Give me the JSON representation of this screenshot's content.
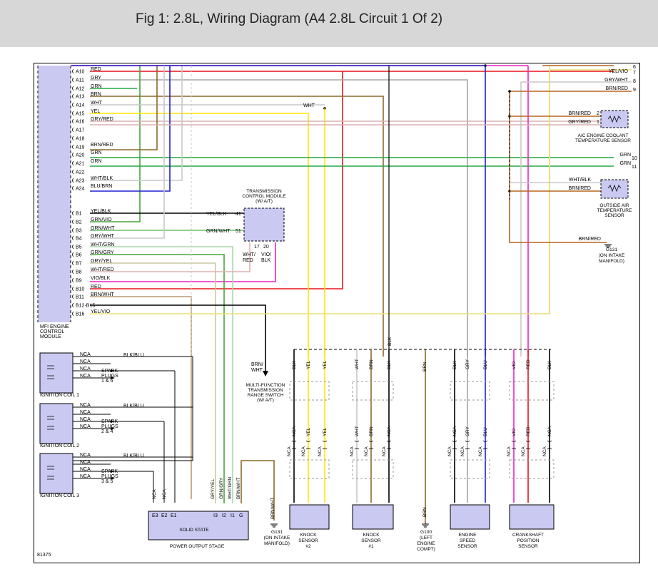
{
  "header": {
    "title": "Fig 1: 2.8L, Wiring Diagram (A4 2.8L Circuit 1 Of 2)"
  },
  "figure_number": "81375",
  "ecm": {
    "label_lines": [
      "MFI ENGINE",
      "CONTROL",
      "MODULE"
    ],
    "pins": [
      {
        "pin": "A10",
        "wire": "RED",
        "color": "#e8141b"
      },
      {
        "pin": "A11",
        "wire": "GRY",
        "color": "#a6a6a6"
      },
      {
        "pin": "A12",
        "wire": "GRN",
        "color": "#22a845"
      },
      {
        "pin": "A13",
        "wire": "BRN",
        "color": "#8a6a2b"
      },
      {
        "pin": "A14",
        "wire": "WHT",
        "color": "#bdbdbd"
      },
      {
        "pin": "A15",
        "wire": "YEL",
        "color": "#ffee00"
      },
      {
        "pin": "A16",
        "wire": "GRY/RED",
        "color": "#d8b0b0"
      },
      {
        "pin": "A17",
        "wire": "",
        "color": ""
      },
      {
        "pin": "A18",
        "wire": "",
        "color": ""
      },
      {
        "pin": "A19",
        "wire": "BRN/RED",
        "color": "#b5651d"
      },
      {
        "pin": "A20",
        "wire": "GRN",
        "color": "#22a845"
      },
      {
        "pin": "A21",
        "wire": "GRN",
        "color": "#22a845"
      },
      {
        "pin": "A22",
        "wire": "",
        "color": ""
      },
      {
        "pin": "A23",
        "wire": "WHT/BLK",
        "color": "#c8c8c8"
      },
      {
        "pin": "A24",
        "wire": "BLU/BRN",
        "color": "#3b3bd0"
      },
      {
        "pin": "B1",
        "wire": "YEL/BLK",
        "color": "#000000"
      },
      {
        "pin": "B2",
        "wire": "GRN/VIO",
        "color": "#4aa43c"
      },
      {
        "pin": "B3",
        "wire": "GRN/WHT",
        "color": "#6dbb6d"
      },
      {
        "pin": "B4",
        "wire": "GRY/WHT",
        "color": "#c8c8c8"
      },
      {
        "pin": "B5",
        "wire": "WHT/GRN",
        "color": "#a8d8a8"
      },
      {
        "pin": "B6",
        "wire": "GRN/GRY",
        "color": "#4aa43c"
      },
      {
        "pin": "B7",
        "wire": "GRY/YEL",
        "color": "#c8c8a0"
      },
      {
        "pin": "B8",
        "wire": "WHT/RED",
        "color": "#e0b0b0"
      },
      {
        "pin": "B9",
        "wire": "VIO/BLK",
        "color": "#ee22cc"
      },
      {
        "pin": "B10",
        "wire": "RED",
        "color": "#e8141b"
      },
      {
        "pin": "B11",
        "wire": "BRN/WHT",
        "color": "#b89b70"
      },
      {
        "pin": "B12-B15",
        "wire": "",
        "color": ""
      },
      {
        "pin": "B16",
        "wire": "YEL/VIO",
        "color": "#ece070"
      }
    ]
  },
  "top_right_wires": [
    {
      "label": "",
      "num": "6"
    },
    {
      "label": "YEL/VIO",
      "num": "7"
    },
    {
      "label": "GRY/WHT",
      "num": "8"
    },
    {
      "label": "BRN/RED",
      "num": "9"
    }
  ],
  "wht_label": "WHT",
  "tcm": {
    "label_lines": [
      "TRANSMISSION",
      "CONTROL MODULE",
      "(W/ A/T)"
    ],
    "pin41": "41",
    "pin51": "51",
    "pin17": "17",
    "pin20": "20",
    "wire41": "YEL/BLK",
    "wire51": "GRN/WHT",
    "wire17_lines": [
      "WHT/",
      "RED"
    ],
    "wire20_lines": [
      "VIO/",
      "BLK"
    ]
  },
  "coolant_sensor": {
    "wires": [
      "BRN/RED",
      "GRY/RED"
    ],
    "pins": [
      "2",
      "1"
    ],
    "label_lines": [
      "A/C ENGINE COOLANT",
      "TEMPERATURE SENSOR"
    ]
  },
  "grn_wires": [
    {
      "label": "GRN",
      "num": "10"
    },
    {
      "label": "GRN",
      "num": "11"
    }
  ],
  "outside_air_sensor": {
    "wires": [
      "WHT/BLK",
      "BRN/RED"
    ],
    "label_lines": [
      "OUTSIDE AIR",
      "TEMPERATURE",
      "SENSOR"
    ]
  },
  "g131_right": {
    "wire": "BRN/RED",
    "label_lines": [
      "G131",
      "(ON INTAKE",
      "MANIFOLD)"
    ]
  },
  "mftrs": {
    "wire_lines": [
      "BRN/",
      "WHT"
    ],
    "label_lines": [
      "MULTI-FUNCTION",
      "TRANSMISSION",
      "RANGE SWITCH",
      "(W/ A/T)"
    ]
  },
  "coils": [
    {
      "label": "IGNITION COIL 1",
      "ground": "BLK/BLU",
      "nca": [
        "NCA",
        "NCA",
        "NCA",
        "NCA"
      ],
      "plugs_lines": [
        "SPARK",
        "PLUGS",
        "1 & 6"
      ]
    },
    {
      "label": "IGNITION COIL 2",
      "ground": "BLK/BLU",
      "nca": [
        "NCA",
        "NCA",
        "NCA",
        "NCA"
      ],
      "plugs_lines": [
        "SPARK",
        "PLUGS",
        "2 & 4"
      ]
    },
    {
      "label": "IGNITION COIL 3",
      "ground": "BLK/BLU",
      "nca": [
        "NCA",
        "NCA",
        "NCA",
        "NCA"
      ],
      "plugs_lines": [
        "SPARK",
        "PLUGS",
        "3 & 5"
      ]
    }
  ],
  "output_stage": {
    "label": "SOLID STATE",
    "caption": "POWER OUTPUT STAGE",
    "pins": [
      "E3",
      "E2",
      "E1",
      "I3",
      "I2",
      "I1",
      "G"
    ],
    "nca_labels": [
      "NCA",
      "NCA"
    ],
    "input_wires": [
      "GRY/YEL",
      "GRN/GRY",
      "WHT/GRN",
      "BRN/WHT"
    ],
    "wire_nums": [
      "1",
      "2",
      "3",
      "4",
      "1",
      "2",
      "3",
      "4"
    ]
  },
  "g131_left": {
    "wire": "BRN/WHT",
    "label_lines": [
      "G131",
      "(ON INTAKE",
      "MANIFOLD)"
    ]
  },
  "g100": {
    "wire": "BRN",
    "label_lines": [
      "G100",
      "(LEFT",
      "ENGINE",
      "COMPT)"
    ]
  },
  "blk_label": "BLK",
  "sensors": [
    {
      "name": "knock2",
      "label_lines": [
        "KNOCK",
        "SENSOR",
        "#2"
      ],
      "top_wires": [
        "BLK",
        "YEL",
        "YEL"
      ],
      "mid_wires": [
        "NCA",
        "YEL",
        "YEL"
      ],
      "nca": [
        "NCA",
        "NCA",
        "NCA"
      ]
    },
    {
      "name": "knock1",
      "label_lines": [
        "KNOCK",
        "SENSOR",
        "#1"
      ],
      "top_wires": [
        "WHT",
        "BRN",
        "BLK"
      ],
      "mid_wires": [
        "WHT",
        "BRN",
        "NCA"
      ],
      "nca": [
        "NCA",
        "NCA",
        "NCA"
      ]
    },
    {
      "name": "speed",
      "label_lines": [
        "ENGINE",
        "SPEED",
        "SENSOR"
      ],
      "top_wires": [
        "BLK",
        "GRY",
        "BLU"
      ],
      "mid_wires": [
        "NCA",
        "GRY",
        "BLU"
      ],
      "nca": [
        "NCA",
        "NCA",
        "NCA"
      ]
    },
    {
      "name": "crank",
      "label_lines": [
        "CRANKSHAFT",
        "POSITION",
        "SENSOR"
      ],
      "top_wires": [
        "VIO",
        "RED",
        "BLK"
      ],
      "mid_wires": [
        "VIO",
        "RED",
        "NCA"
      ],
      "nca": [
        "NCA",
        "NCA",
        "NCA"
      ]
    }
  ],
  "g100_wire_top": "BRN"
}
